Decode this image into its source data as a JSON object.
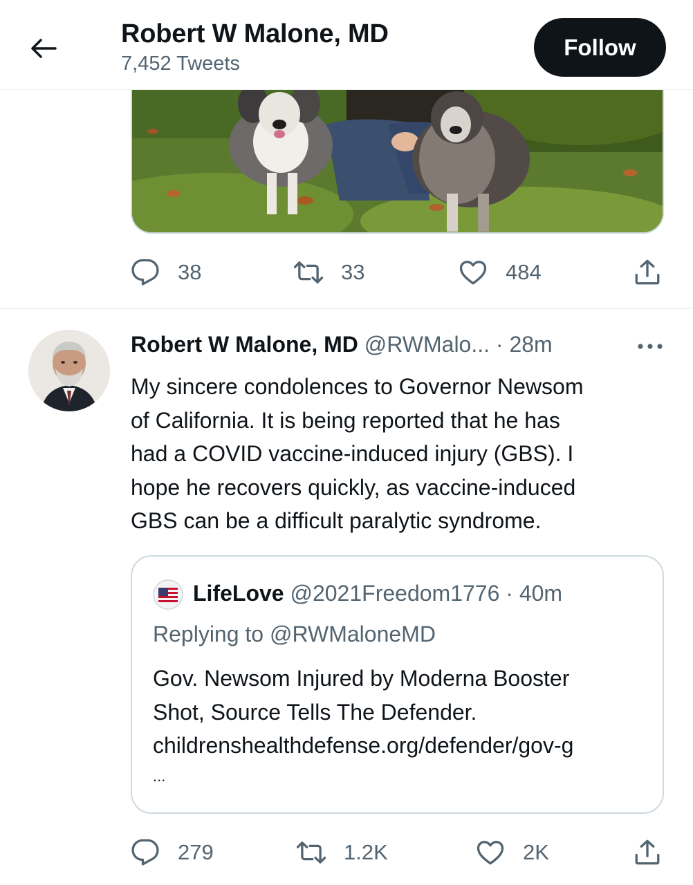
{
  "header": {
    "title": "Robert W Malone, MD",
    "tweet_count": "7,452 Tweets",
    "follow_label": "Follow",
    "back_icon": "arrow-left-icon"
  },
  "prev_tweet": {
    "actions": {
      "replies": "38",
      "retweets": "33",
      "likes": "484"
    }
  },
  "tweet": {
    "name": "Robert W Malone, MD",
    "handle": "@RWMalo...",
    "separator": "·",
    "time": "28m",
    "text_lines": [
      "My sincere condolences to Governor Newsom",
      "of California.  It is being reported that he has",
      "had a COVID vaccine-induced injury (GBS).  I",
      "hope he recovers quickly, as vaccine-induced",
      "GBS can be a difficult paralytic syndrome."
    ],
    "quote": {
      "name": "LifeLove",
      "handle": "@2021Freedom1776",
      "separator": "·",
      "time": "40m",
      "replying_to": "Replying to @RWMaloneMD",
      "text_lines": [
        "Gov. Newsom Injured by Moderna Booster",
        "Shot, Source Tells The Defender.",
        "childrenshealthdefense.org/defender/gov-g",
        "..."
      ]
    },
    "actions": {
      "replies": "279",
      "retweets": "1.2K",
      "likes": "2K"
    }
  },
  "icons": {
    "reply": "reply-icon",
    "retweet": "retweet-icon",
    "like": "heart-icon",
    "share": "share-icon",
    "more": "more-icon"
  },
  "colors": {
    "text": "#0f1419",
    "secondary": "#536471",
    "border": "#cfd9de",
    "follow_bg": "#0f1419"
  }
}
